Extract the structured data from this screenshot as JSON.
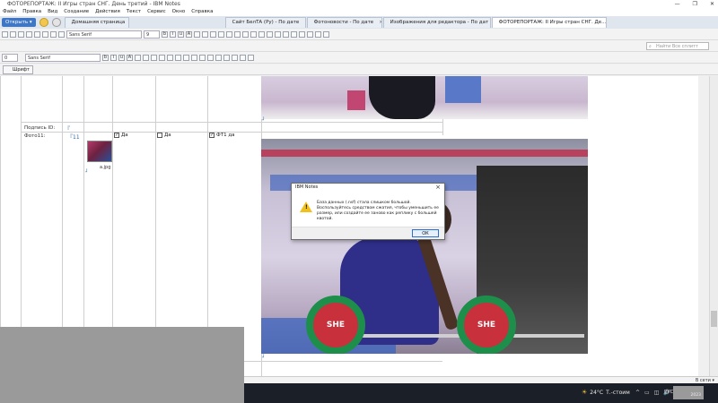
{
  "window": {
    "title": "ФОТОРЕПОРТАЖ: II Игры стран СНГ. День третий - IBM Notes",
    "controls": [
      "—",
      "❐",
      "✕"
    ]
  },
  "menu": [
    "Файл",
    "Правка",
    "Вид",
    "Создание",
    "Действия",
    "Текст",
    "Сервис",
    "Окно",
    "Справка"
  ],
  "tabs": {
    "open_button": "Открыть ▾",
    "items": [
      {
        "label": "Домашняя страница",
        "active": false
      },
      {
        "label": "Сайт БелТА (Ру) - По дате",
        "active": false
      },
      {
        "label": "Фотоновости - По дате",
        "active": false
      },
      {
        "label": "Изображения для редактора - По дат",
        "active": false
      },
      {
        "label": "ФОТОРЕПОРТАЖ: II Игры стран СНГ. Де...",
        "active": true
      }
    ]
  },
  "toolbar": {
    "font_name": "Sans Serif",
    "font_size": "9",
    "style_select": "0",
    "search_placeholder": "Найти Все сплитт"
  },
  "format_bar": {
    "shrift_button": "Шрифт"
  },
  "document": {
    "podpis_label": "Подпись ID:",
    "foto_label": "Фото11:",
    "field_marker": "『",
    "field_marker_ph": "『11",
    "thumb_caption": "a.jpg",
    "checkbox_da1": "Да",
    "checkbox_da2": "Да",
    "checkbox_ft": "ФТ1 да",
    "corner_mark_1": "┘",
    "corner_mark_2": "┘",
    "corner_mark_3": "┘"
  },
  "photo": {
    "plate_text_left": "SHE",
    "plate_text_right": "SHE"
  },
  "dialog": {
    "title": "IBM Notes",
    "message": "База данных (.nsf) стала слишком большой. Воспользуйтесь средством сжатия, чтобы уменьшить ее размер, или создайте ее заново как реплику с большей квотой.",
    "ok_label": "ОК"
  },
  "status": {
    "online": "В сети ▾"
  },
  "taskbar": {
    "weather_temp": "24°C",
    "weather_text": "Т.-стоим",
    "tray_icons": [
      "^",
      "▭",
      "◫",
      "🔊"
    ],
    "lang": "РУС",
    "clock_date": "2023"
  },
  "colors": {
    "accent": "#3f77c4",
    "dialog_warning": "#f1c01c",
    "taskbar": "#1b1f27"
  }
}
